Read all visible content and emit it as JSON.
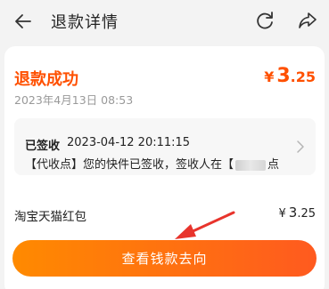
{
  "header": {
    "title": "退款详情",
    "back_icon": "arrow-left-icon",
    "refresh_icon": "refresh-icon",
    "share_icon": "share-icon"
  },
  "refund": {
    "status": "退款成功",
    "currency": "¥",
    "amount_int": "3",
    "amount_dec": ".25",
    "time": "2023年4月13日 08:53"
  },
  "logistics": {
    "status": "已签收",
    "time": "2023-04-12 20:11:15",
    "desc_prefix": "【代收点】您的快件已签收，签收人在【",
    "desc_suffix": "点"
  },
  "refund_method": {
    "label": "淘宝天猫红包",
    "currency": "¥",
    "amount_int": "3",
    "amount_dec": ".25"
  },
  "cta": {
    "label": "查看钱款去向"
  },
  "colors": {
    "accent": "#ff5000",
    "annotation": "#e8342c"
  }
}
